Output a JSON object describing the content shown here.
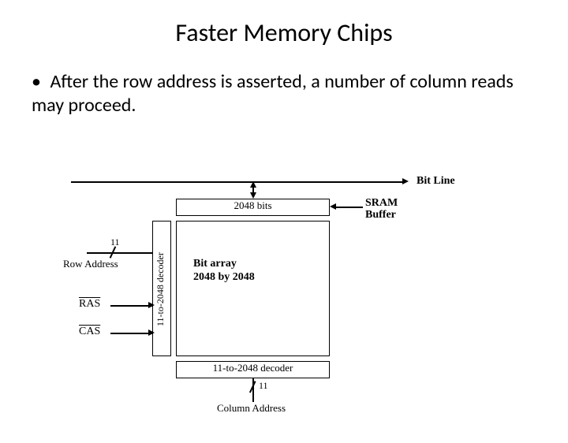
{
  "title": "Faster Memory Chips",
  "bullet": "After the row address is asserted, a number of column reads may proceed.",
  "diagram": {
    "bit_line": "Bit Line",
    "sram_buffer_l1": "SRAM",
    "sram_buffer_l2": "Buffer",
    "buffer_label": "2048 bits",
    "array_l1": "Bit array",
    "array_l2": "2048 by 2048",
    "row_decoder": "11-to-2048 decoder",
    "col_decoder": "11-to-2048 decoder",
    "row_addr": "Row Address",
    "col_addr": "Column Address",
    "ras": "RAS",
    "cas": "CAS",
    "bus_width": "11"
  }
}
